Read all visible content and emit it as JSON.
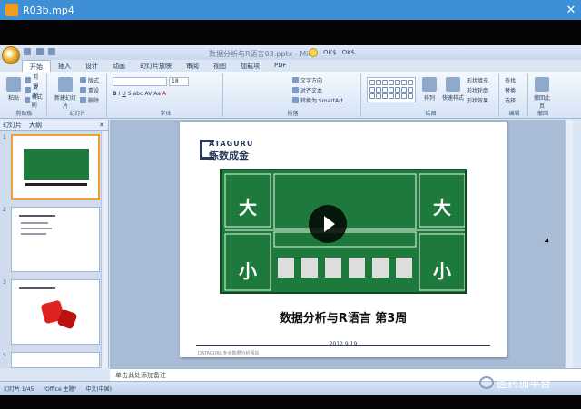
{
  "player": {
    "title": "R03b.mp4",
    "close": "✕"
  },
  "ppt": {
    "doc_title": "数据分析与R语言03.pptx - Mic",
    "extras": [
      "OK$",
      "OK$"
    ],
    "tabs": [
      "开始",
      "插入",
      "设计",
      "动画",
      "幻灯片放映",
      "审阅",
      "视图",
      "加载项",
      "PDF"
    ],
    "groups": {
      "clipboard": {
        "label": "剪贴板",
        "paste": "粘贴",
        "items": [
          "剪切",
          "复制",
          "格式刷"
        ]
      },
      "slides": {
        "label": "幻灯片",
        "new_slide": "新建幻灯片",
        "items": [
          "版式",
          "重设",
          "删除"
        ]
      },
      "font": {
        "label": "字体",
        "size": "18",
        "items": [
          "B",
          "I",
          "U",
          "S",
          "abc",
          "AV",
          "Aa",
          "A"
        ]
      },
      "paragraph": {
        "label": "段落",
        "items": [
          "文字方向",
          "对齐文本",
          "转换为 SmartArt"
        ]
      },
      "drawing": {
        "label": "绘图",
        "items": [
          "排列",
          "快速样式",
          "形状填充",
          "形状轮廓",
          "形状效果"
        ]
      },
      "editing": {
        "label": "编辑",
        "items": [
          "查找",
          "替换",
          "选择"
        ]
      },
      "recall": {
        "label": "撤回",
        "item": "撤回此页"
      }
    },
    "pane_tabs": [
      "幻灯片",
      "大纲",
      "✕"
    ],
    "thumbs": [
      "1",
      "2",
      "3",
      "4"
    ],
    "slide": {
      "brand": "ATAGURU",
      "brand_cn": "炼数成金",
      "title": "数据分析与R语言 第3周",
      "date": "2012.9.19",
      "footer": "DATAGURU专业数据分析网站"
    },
    "notes": "单击此处添加备注",
    "status": [
      "幻灯片 1/45",
      "\"Office 主题\"",
      "中文(中国)"
    ]
  },
  "watermark": "医药加平台"
}
